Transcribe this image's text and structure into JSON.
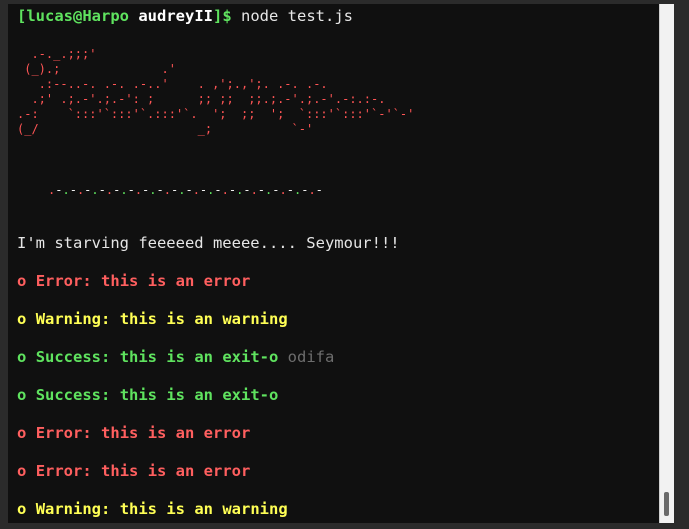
{
  "prompt": {
    "user_host": "[lucas@Harpo",
    "cwd": "audreyII",
    "symbol": "]$",
    "command": "node test.js"
  },
  "ascii_art": {
    "lines": [
      "  .-._.;;;'",
      " (_).;              .'",
      "   .:--..-. .-. .-..'    . ,';.,';. .-. .-.",
      "  .;' .;.-'.;.-': ;      ;; ;;  ;;.;.-'.;.-'.-:.:-.",
      ".-:    `:::'`:::'`.:::'`.  ';  ;;  ';  `:::'`:::'`-'`-'",
      "(_/                      _;           `-'"
    ],
    "divider": ".-.-.-.-.-.-.-.-.-.-.-.-.-.-.-.-.-.-.-"
  },
  "output": {
    "starving": "I'm starving feeeeed meeee.... Seymour!!!",
    "bullet": "o",
    "error_label": "Error:",
    "error_text": "this is an error",
    "warning_label": "Warning:",
    "warning_text": "this is an warning",
    "success_label": "Success:",
    "success_text": "this is an exit-o",
    "ghost_text": "odifa"
  },
  "colors": {
    "error": "#ff5f5f",
    "warning": "#ffff55",
    "success": "#5fe35f",
    "prompt": "#5fe35f",
    "background": "#101010"
  }
}
